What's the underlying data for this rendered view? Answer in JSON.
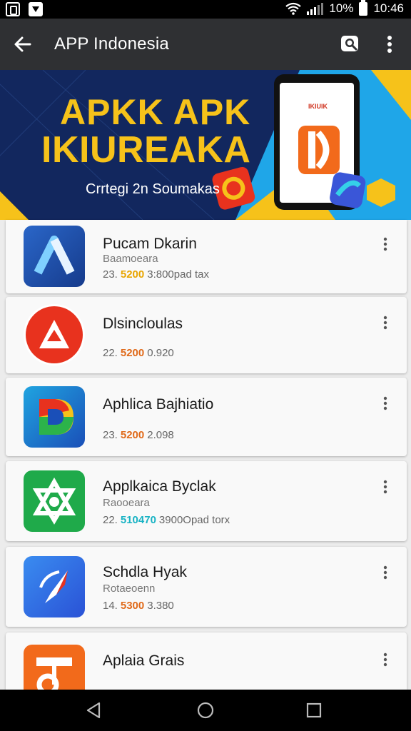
{
  "status_bar": {
    "battery": "10%",
    "time": "10:46",
    "icons": [
      "k-app-icon",
      "download-icon",
      "wifi-icon",
      "signal-icon",
      "battery-icon"
    ]
  },
  "app_bar": {
    "title": "APP Indonesia",
    "icons": [
      "back-arrow-icon",
      "search-icon",
      "more-vert-icon"
    ]
  },
  "banner": {
    "headline_1": "APKK APK",
    "headline_2": "IKIUREAKA",
    "subtitle": "Crrtegi 2n Soumakas",
    "phone_label": "IKIUIK"
  },
  "apps": [
    {
      "name": "Pucam Dkarin",
      "subtitle": "Baamoeara",
      "meta_prefix": "23.",
      "meta_accent": "5200",
      "meta_rest": "3:800pad tax",
      "accent_color": "#e8a500",
      "icon": "blue-a-logo-icon"
    },
    {
      "name": "Dlsincloulas",
      "subtitle": "",
      "meta_prefix": "22.",
      "meta_accent": "5200",
      "meta_rest": "0.920",
      "accent_color": "#e06a1a",
      "icon": "red-a-logo-icon"
    },
    {
      "name": "Aphlica Bajhiatio",
      "subtitle": "",
      "meta_prefix": "23.",
      "meta_accent": "5200",
      "meta_rest": "2.098",
      "accent_color": "#e06a1a",
      "icon": "colorful-d-logo-icon"
    },
    {
      "name": "Applkaica Byclak",
      "subtitle": "Raooeara",
      "meta_prefix": "22.",
      "meta_accent": "510470",
      "meta_rest": "3900Opad torx",
      "accent_color": "#19b3c4",
      "icon": "green-star-logo-icon"
    },
    {
      "name": "Schdla Hyak",
      "subtitle": "Rotaeoenn",
      "meta_prefix": "14.",
      "meta_accent": "5300",
      "meta_rest": "3.380",
      "accent_color": "#e06a1a",
      "icon": "blue-compass-logo-icon"
    },
    {
      "name": "Aplaia Grais",
      "subtitle": "",
      "meta_prefix": "",
      "meta_accent": "",
      "meta_rest": "",
      "accent_color": "#e06a1a",
      "icon": "orange-music-logo-icon"
    }
  ],
  "nav_bar": {
    "icons": [
      "nav-back-icon",
      "nav-home-icon",
      "nav-recents-icon"
    ]
  }
}
